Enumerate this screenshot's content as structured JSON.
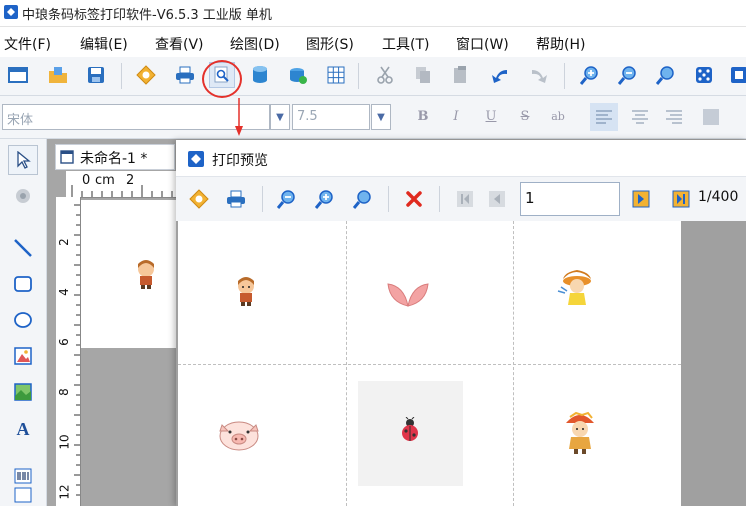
{
  "app": {
    "title": "中琅条码标签打印软件-V6.5.3 工业版 单机"
  },
  "menu": {
    "items": [
      "文件(F)",
      "编辑(E)",
      "查看(V)",
      "绘图(D)",
      "图形(S)",
      "工具(T)",
      "窗口(W)",
      "帮助(H)"
    ]
  },
  "toolbar": {
    "buttons": [
      "new-icon",
      "open-icon",
      "save-icon",
      "settings-icon",
      "print-icon",
      "print-preview-icon",
      "database-icon",
      "data-source-icon",
      "grid-icon",
      "cut-icon",
      "copy-icon",
      "paste-icon",
      "undo-icon",
      "redo-icon",
      "zoom-in-icon",
      "zoom-out-icon",
      "zoom-fit-icon",
      "fullscreen-icon"
    ],
    "highlighted": "print-preview-icon"
  },
  "format_bar": {
    "font_name": "宋体",
    "font_size": "7.5"
  },
  "document": {
    "tab_label": "未命名-1 *",
    "ruler_unit": "cm",
    "ruler_h_labels": [
      "0",
      "cm",
      "2"
    ],
    "ruler_v_labels": [
      "2",
      "4",
      "6",
      "8",
      "10",
      "12"
    ]
  },
  "preview": {
    "title": "打印预览",
    "current_page": "1",
    "total_pages": "1/400",
    "labels": [
      {
        "icon": "girl-character"
      },
      {
        "icon": "pink-leaves"
      },
      {
        "icon": "dancing-girl"
      },
      {
        "icon": "pig-face"
      },
      {
        "icon": "ladybug"
      },
      {
        "icon": "hat-character"
      }
    ]
  },
  "colors": {
    "accent": "#1e63c7",
    "highlight_circle": "#e4312b",
    "delete_red": "#e02a1f"
  }
}
